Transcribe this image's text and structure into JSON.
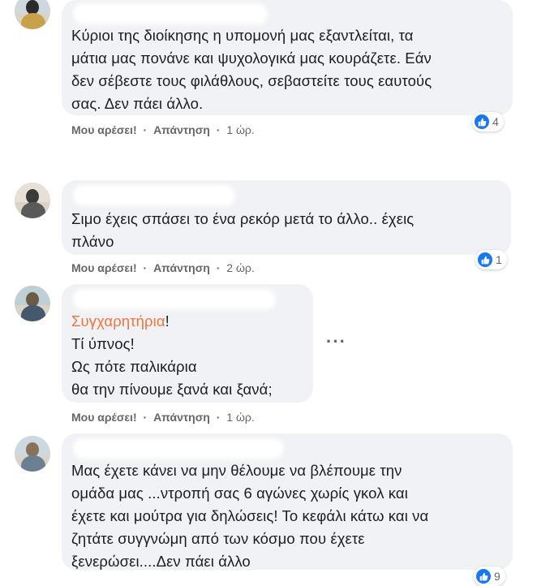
{
  "comments": [
    {
      "lines": [
        "Κύριοι της διοίκησης η υπομονή μας εξαντλείται, τα",
        "μάτια μας πονάνε και ψυχολογικά μας κουράζετε. Εάν",
        "δεν σέβεστε τους φιλάθλους, σεβαστείτε τους εαυτούς",
        "σας. Δεν πάει άλλο."
      ],
      "like_label": "Μου αρέσει!",
      "reply_label": "Απάντηση",
      "separator": "·",
      "time": "1 ώρ.",
      "reaction_count": "4"
    },
    {
      "lines": [
        "Σιμο έχεις σπάσει το ένα ρεκόρ μετά το άλλο.. έχεις",
        "πλάνο"
      ],
      "like_label": "Μου αρέσει!",
      "reply_label": "Απάντηση",
      "separator": "·",
      "time": "2 ώρ.",
      "reaction_count": "1"
    },
    {
      "highlight": "Συγχαρητήρια",
      "highlight_suffix": "!",
      "lines": [
        "Τί ύπνος!",
        "Ως πότε παλικάρια",
        "θα την πίνουμε ξανά και ξανά;"
      ],
      "like_label": "Μου αρέσει!",
      "reply_label": "Απάντηση",
      "separator": "·",
      "time": "1 ώρ.",
      "more_icon": "more-horizontal-icon"
    },
    {
      "lines": [
        "Μας έχετε κάνει να μην θέλουμε να βλέπουμε την",
        "ομάδα μας ...ντροπή σας 6 αγώνες χωρίς γκολ και",
        "έχετε και μούτρα για δηλώσεις! Το κεφάλι κάτω και να",
        "ζητάτε συγγνώμη από των κόσμο που έχετε",
        "ξενερώσει....Δεν πάει άλλο"
      ],
      "reaction_count": "9"
    }
  ],
  "colors": {
    "bubble_bg": "#f0f2f5",
    "meta_text": "#65676b",
    "highlight": "#f0743e",
    "like_blue": "#1877f2"
  }
}
